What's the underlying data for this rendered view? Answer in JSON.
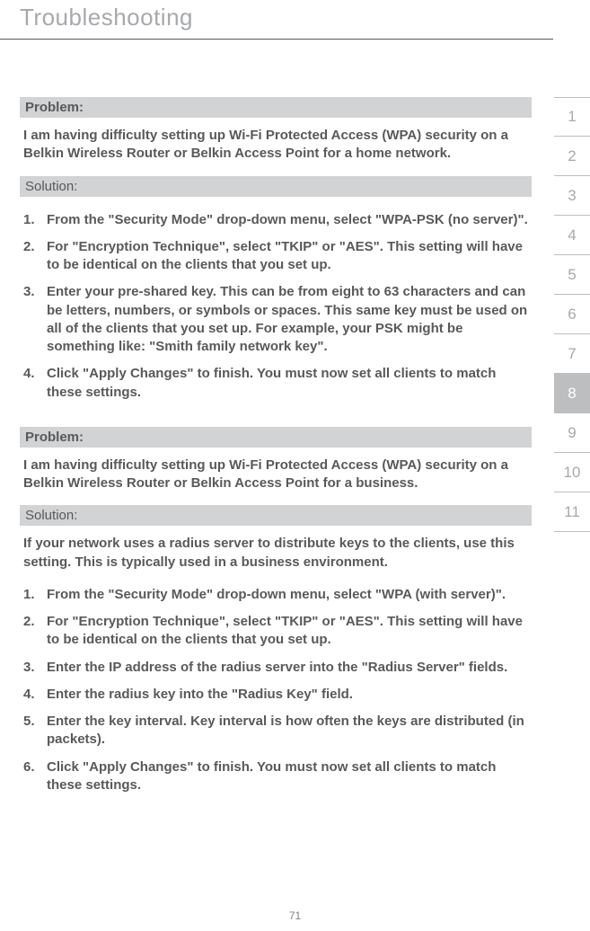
{
  "header": {
    "title": "Troubleshooting"
  },
  "tabs": [
    "1",
    "2",
    "3",
    "4",
    "5",
    "6",
    "7",
    "8",
    "9",
    "10",
    "11"
  ],
  "activeTabIndex": 7,
  "sections": [
    {
      "problemLabel": "Problem:",
      "problemText": "I am having difficulty setting up Wi-Fi Protected Access (WPA) security on a Belkin Wireless Router or Belkin Access Point for a home network.",
      "solutionLabel": "Solution:",
      "intro": "",
      "steps": [
        "From the \"Security Mode\" drop-down menu, select \"WPA-PSK (no server)\".",
        "For \"Encryption Technique\", select \"TKIP\" or \"AES\". This setting will have to be identical on the clients that you set up.",
        "Enter your pre-shared key. This can be from eight to 63 characters and can be letters, numbers, or symbols or spaces. This same key must be used on all of the clients that you set up. For example, your PSK might be something like: \"Smith family network key\".",
        "Click \"Apply Changes\" to finish. You must now set all clients to match these settings."
      ]
    },
    {
      "problemLabel": "Problem:",
      "problemText": "I am having difficulty setting up Wi-Fi Protected Access (WPA) security on a Belkin Wireless Router or Belkin Access Point for a business.",
      "solutionLabel": "Solution:",
      "intro": "If your network uses a radius server to distribute keys to the clients, use this setting. This is typically used in a business environment.",
      "steps": [
        "From the \"Security Mode\" drop-down menu, select \"WPA (with server)\".",
        "For \"Encryption Technique\", select \"TKIP\" or \"AES\". This setting will have to be identical on the clients that you set up.",
        "Enter the IP address of the radius server into the \"Radius Server\" fields.",
        "Enter the radius key into the \"Radius Key\" field.",
        "Enter the key interval. Key interval is how often the keys are distributed (in packets).",
        "Click \"Apply Changes\" to finish. You must now set all clients to match these settings."
      ]
    }
  ],
  "pageNumber": "71"
}
